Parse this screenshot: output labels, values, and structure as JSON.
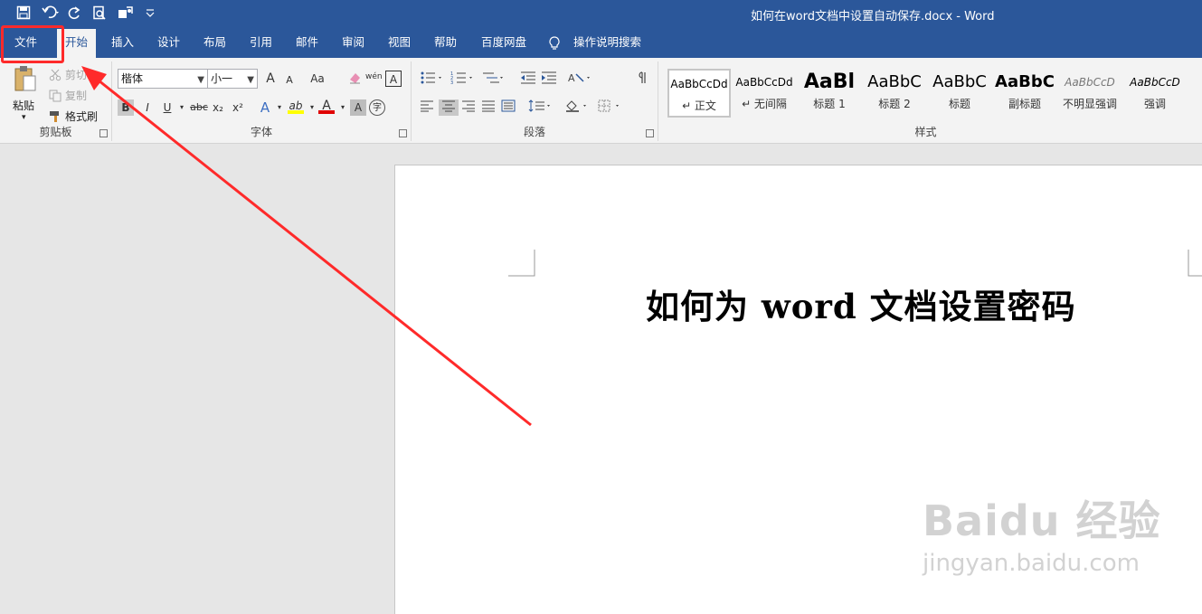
{
  "window": {
    "title": "如何在word文档中设置自动保存.docx  -  Word"
  },
  "quick_access": {
    "icons": [
      "save-icon",
      "undo-icon",
      "redo-icon",
      "print-preview-icon",
      "touch-mode-icon",
      "customize-qat-icon"
    ]
  },
  "tabs": [
    {
      "label": "文件"
    },
    {
      "label": "开始"
    },
    {
      "label": "插入"
    },
    {
      "label": "设计"
    },
    {
      "label": "布局"
    },
    {
      "label": "引用"
    },
    {
      "label": "邮件"
    },
    {
      "label": "审阅"
    },
    {
      "label": "视图"
    },
    {
      "label": "帮助"
    },
    {
      "label": "百度网盘"
    },
    {
      "label": "操作说明搜索"
    }
  ],
  "ribbon": {
    "clipboard": {
      "paste_label": "粘贴",
      "cut_label": "剪切",
      "copy_label": "复制",
      "format_painter_label": "格式刷",
      "group_label": "剪贴板"
    },
    "font": {
      "font_name": "楷体",
      "font_size": "小一",
      "group_label": "字体",
      "grow_font": "A",
      "shrink_font": "A",
      "change_case": "Aa",
      "phonetic": "wén",
      "char_border": "A",
      "bold": "B",
      "italic": "I",
      "underline": "U",
      "strikethrough": "abc",
      "subscript": "x₂",
      "superscript": "x²",
      "text_effects": "A",
      "highlight": "ab",
      "font_color": "A",
      "char_shading": "A",
      "enclose": "字"
    },
    "paragraph": {
      "group_label": "段落"
    },
    "styles": {
      "group_label": "样式",
      "items": [
        {
          "sample": "AaBbCcDd",
          "name": "↵ 正文"
        },
        {
          "sample": "AaBbCcDd",
          "name": "↵ 无间隔"
        },
        {
          "sample": "AaBl",
          "name": "标题 1"
        },
        {
          "sample": "AaBbC",
          "name": "标题 2"
        },
        {
          "sample": "AaBbC",
          "name": "标题"
        },
        {
          "sample": "AaBbC",
          "name": "副标题"
        },
        {
          "sample": "AaBbCcD",
          "name": "不明显强调"
        },
        {
          "sample": "AaBbCcD",
          "name": "强调"
        }
      ]
    }
  },
  "document": {
    "heading": "如何为 word 文档设置密码"
  },
  "watermark": {
    "main": "Baidu 经验",
    "sub": "jingyan.baidu.com"
  },
  "colors": {
    "word_blue": "#2b579a",
    "annotation_red": "#ff2a2a"
  }
}
